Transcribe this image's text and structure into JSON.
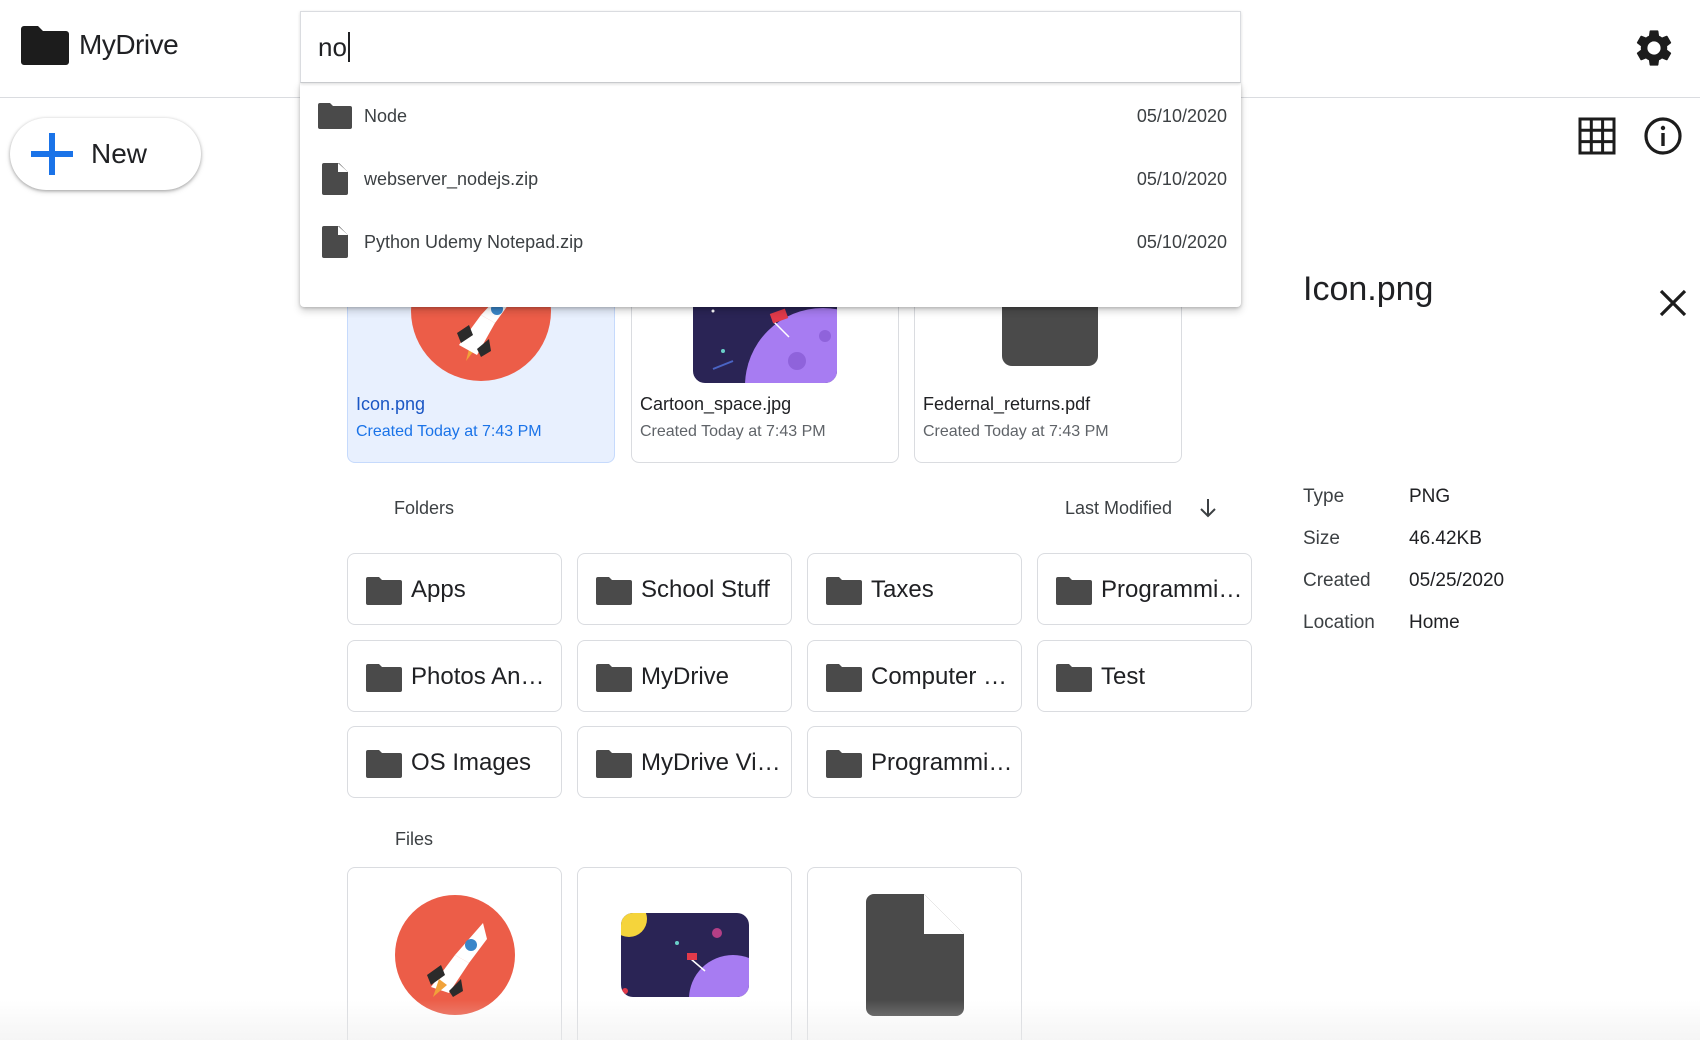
{
  "app": {
    "name": "MyDrive"
  },
  "search": {
    "value": "no",
    "results": [
      {
        "type": "folder",
        "name": "Node",
        "date": "05/10/2020"
      },
      {
        "type": "file",
        "name": "webserver_nodejs.zip",
        "date": "05/10/2020"
      },
      {
        "type": "file",
        "name": "Python Udemy Notepad.zip",
        "date": "05/10/2020"
      }
    ]
  },
  "new_button": {
    "label": "New"
  },
  "quick_access": [
    {
      "name": "Icon.png",
      "subtitle": "Created Today at 7:43 PM",
      "thumb": "rocket-icon",
      "selected": true
    },
    {
      "name": "Cartoon_space.jpg",
      "subtitle": "Created Today at 7:43 PM",
      "thumb": "space-image",
      "selected": false
    },
    {
      "name": "Federnal_returns.pdf",
      "subtitle": "Created Today at 7:43 PM",
      "thumb": "document-icon",
      "selected": false
    }
  ],
  "folders_section": {
    "heading": "Folders",
    "sort_label": "Last Modified",
    "sort_icon": "arrow-down-icon",
    "items": [
      "Apps",
      "School Stuff",
      "Taxes",
      "Programming Stuff",
      "Photos And Videos",
      "MyDrive",
      "Computer Backups",
      "Test",
      "OS Images",
      "MyDrive Videos",
      "Programming Videos"
    ]
  },
  "files_section": {
    "heading": "Files",
    "items": [
      {
        "thumb": "rocket-icon"
      },
      {
        "thumb": "space-image"
      },
      {
        "thumb": "document-icon"
      }
    ]
  },
  "details": {
    "title": "Icon.png",
    "fields": [
      {
        "key": "Type",
        "value": "PNG"
      },
      {
        "key": "Size",
        "value": "46.42KB"
      },
      {
        "key": "Created",
        "value": "05/25/2020"
      },
      {
        "key": "Location",
        "value": "Home"
      }
    ]
  },
  "colors": {
    "accent": "#1a73e8",
    "icon_dark": "#4a4a4a",
    "rocket_bg": "#ec5d48",
    "space_bg": "#2a2455",
    "planet": "#a77cf2",
    "selected_card": "#e8f0fe"
  }
}
